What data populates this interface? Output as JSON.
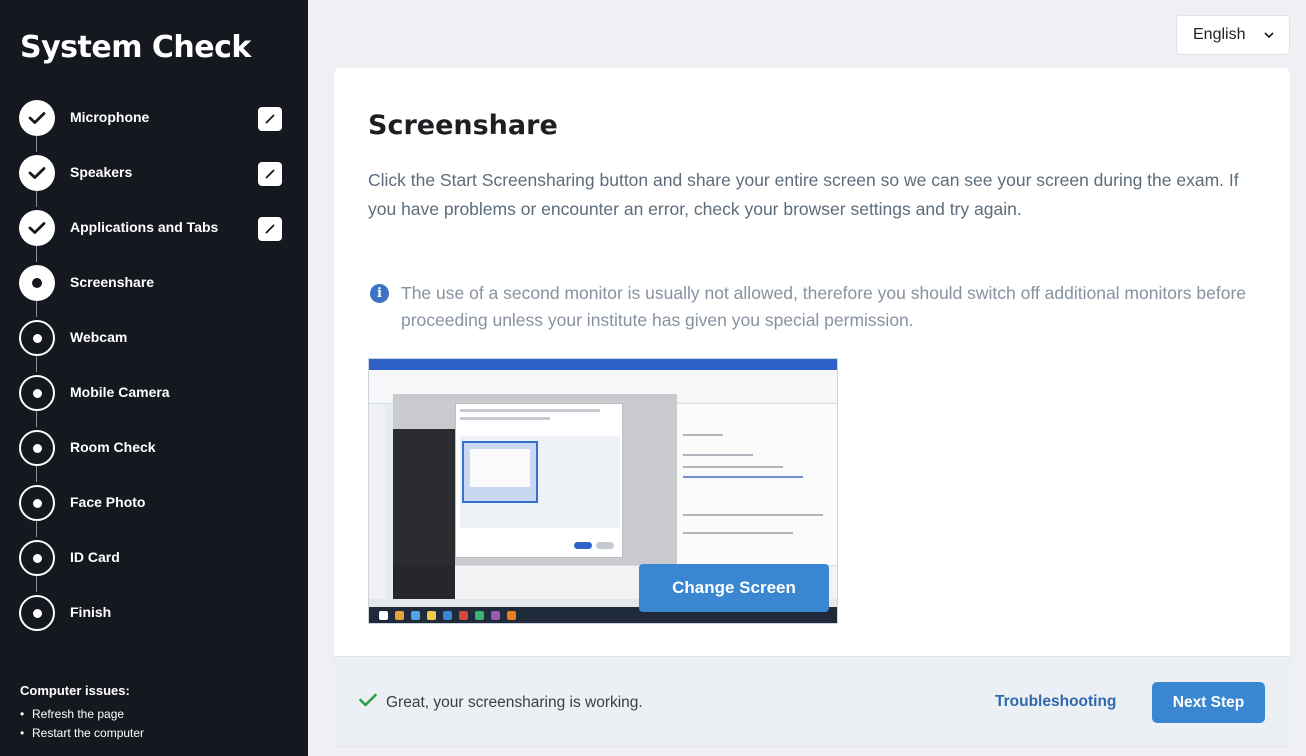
{
  "sidebar": {
    "title": "System Check",
    "steps": [
      {
        "label": "Microphone",
        "state": "done",
        "editable": true
      },
      {
        "label": "Speakers",
        "state": "done",
        "editable": true
      },
      {
        "label": "Applications and Tabs",
        "state": "done",
        "editable": true
      },
      {
        "label": "Screenshare",
        "state": "current",
        "editable": false
      },
      {
        "label": "Webcam",
        "state": "pending",
        "editable": false
      },
      {
        "label": "Mobile Camera",
        "state": "pending",
        "editable": false
      },
      {
        "label": "Room Check",
        "state": "pending",
        "editable": false
      },
      {
        "label": "Face Photo",
        "state": "pending",
        "editable": false
      },
      {
        "label": "ID Card",
        "state": "pending",
        "editable": false
      },
      {
        "label": "Finish",
        "state": "pending",
        "editable": false
      }
    ],
    "issues": {
      "title": "Computer issues:",
      "items": [
        "Refresh the page",
        "Restart the computer"
      ]
    }
  },
  "language": {
    "selected": "English",
    "icon": "chevron-down-icon"
  },
  "main": {
    "title": "Screenshare",
    "description": "Click the Start Screensharing button and share your entire screen so we can see your screen during the exam. If you have problems or encounter an error, check your browser settings and try again.",
    "info": "The use of a second monitor is usually not allowed, therefore you should switch off additional monitors before proceeding unless your institute has given you special permission.",
    "change_screen_label": "Change Screen"
  },
  "footer": {
    "status_text": "Great, your screensharing is working.",
    "troubleshooting_label": "Troubleshooting",
    "next_label": "Next Step"
  },
  "colors": {
    "sidebar_bg": "#15181e",
    "accent": "#3b86d1",
    "link": "#2f69ad",
    "success": "#2e9e44"
  }
}
